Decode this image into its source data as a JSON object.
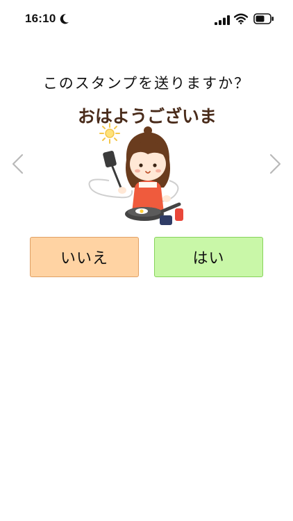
{
  "status_bar": {
    "time": "16:10"
  },
  "dialog": {
    "prompt": "このスタンプを送りますか？",
    "sticker_text": "おはようございます",
    "no_label": "いいえ",
    "yes_label": "はい"
  },
  "icons": {
    "moon": "moon-icon",
    "signal": "cellular-signal-icon",
    "wifi": "wifi-icon",
    "battery": "battery-icon",
    "prev": "chevron-left-icon",
    "next": "chevron-right-icon"
  },
  "colors": {
    "no_button_bg": "#ffd3a3",
    "yes_button_bg": "#c9f7a8",
    "arrow": "#b9b9b9"
  }
}
